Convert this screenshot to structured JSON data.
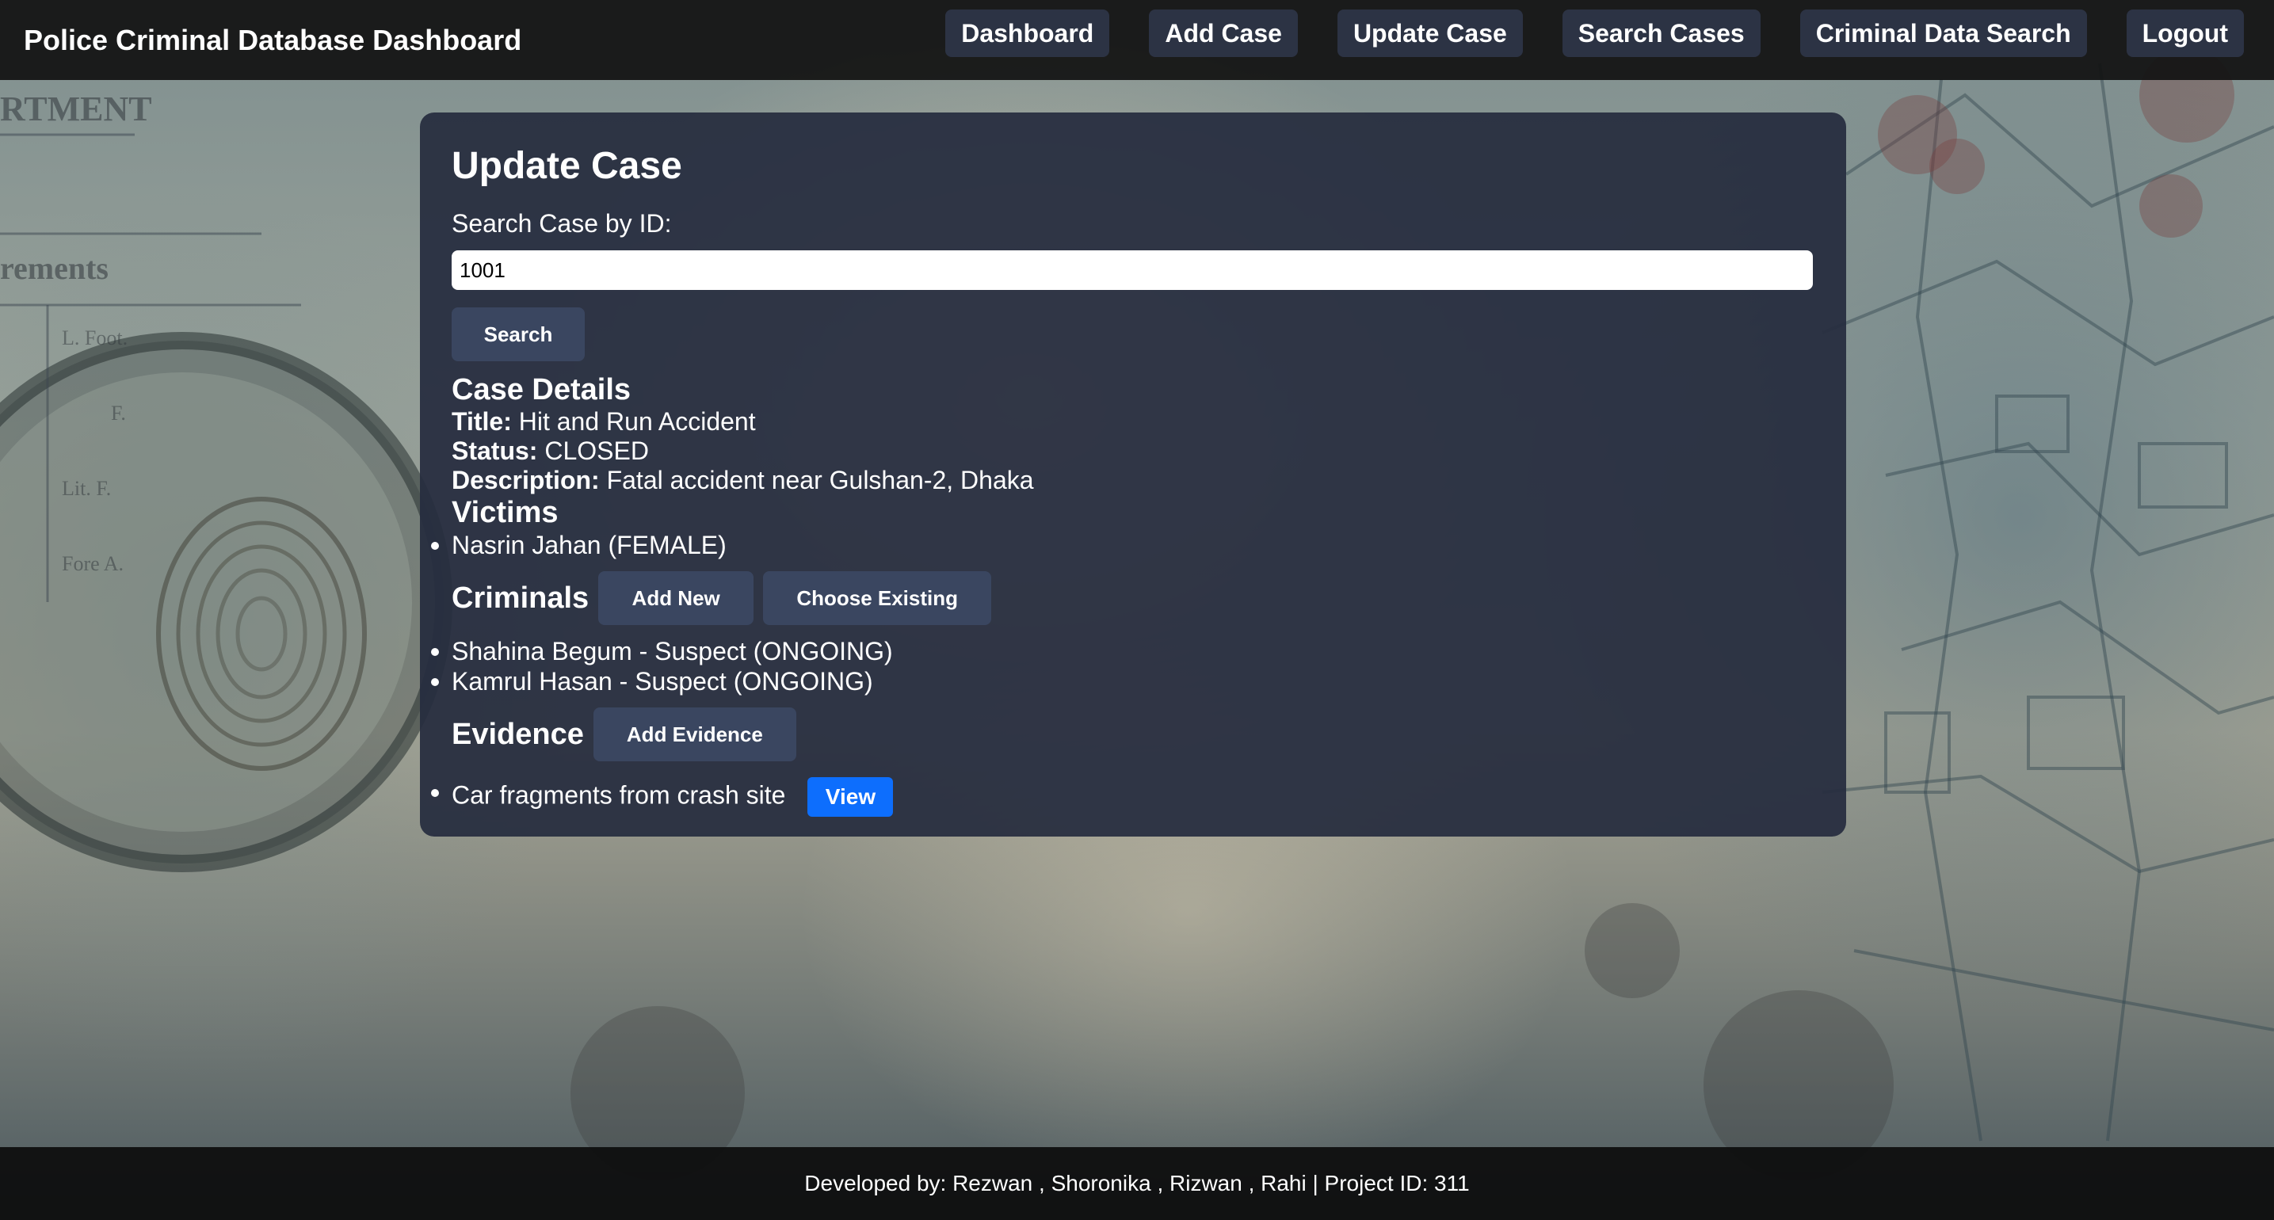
{
  "navbar": {
    "brand": "Police Criminal Database Dashboard",
    "links": [
      "Dashboard",
      "Add Case",
      "Update Case",
      "Search Cases",
      "Criminal Data Search",
      "Logout"
    ]
  },
  "background": {
    "words": [
      "RTMENT",
      "rements",
      "L. Foot.",
      "F.",
      "Lit. F.",
      "Fore A."
    ]
  },
  "update_case": {
    "title": "Update Case",
    "search_label": "Search Case by ID:",
    "search_value": "1001",
    "search_button": "Search"
  },
  "case_details": {
    "heading": "Case Details",
    "title_label": "Title:",
    "title_value": "Hit and Run Accident",
    "status_label": "Status:",
    "status_value": "CLOSED",
    "description_label": "Description:",
    "description_value": "Fatal accident near Gulshan-2, Dhaka"
  },
  "victims": {
    "heading": "Victims",
    "items": [
      "Nasrin Jahan (FEMALE)"
    ]
  },
  "criminals": {
    "heading": "Criminals",
    "add_new_button": "Add New",
    "choose_existing_button": "Choose Existing",
    "items": [
      "Shahina Begum - Suspect (ONGOING)",
      "Kamrul Hasan - Suspect (ONGOING)"
    ]
  },
  "evidence": {
    "heading": "Evidence",
    "add_button": "Add Evidence",
    "items": [
      {
        "label": "Car fragments from crash site",
        "action": "View"
      }
    ]
  },
  "footer": {
    "text": "Developed by: Rezwan , Shoronika , Rizwan , Rahi | Project ID: 311"
  },
  "colors": {
    "navbar_bg": "#121212",
    "nav_button_bg": "#2c3344",
    "panel_bg": "#262c3e",
    "button_bg": "#3a4660",
    "view_button_bg": "#0d6efd",
    "footer_bg": "#0c0c0c"
  }
}
